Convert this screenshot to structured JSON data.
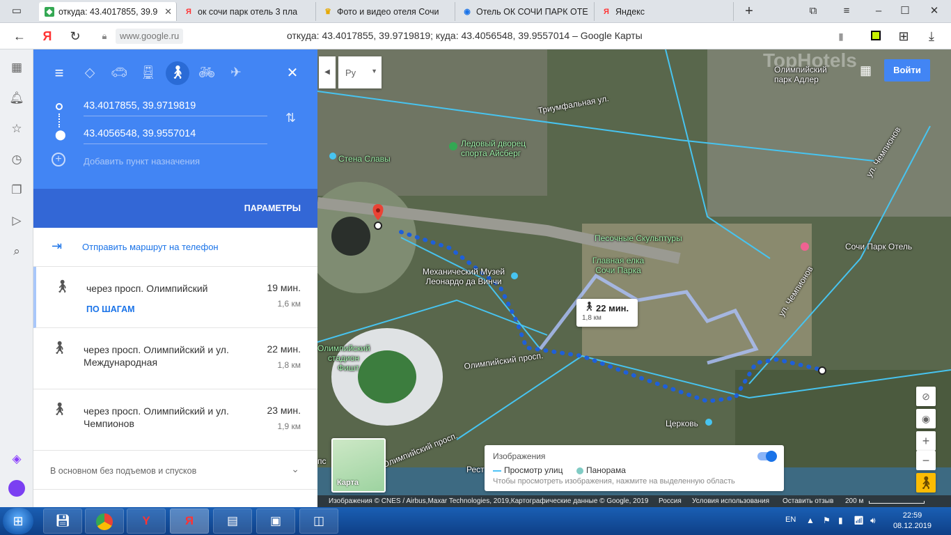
{
  "tabs": [
    {
      "title": "откуда: 43.4017855, 39.9",
      "icon": "google-maps-icon",
      "active": true
    },
    {
      "title": "ок сочи парк отель 3 пла",
      "icon": "yandex-icon"
    },
    {
      "title": "Фото и видео отеля Сочи",
      "icon": "crown-icon"
    },
    {
      "title": "Отель ОК СОЧИ ПАРК ОТЕ",
      "icon": "tripadvisor-icon"
    },
    {
      "title": "Яндекс",
      "icon": "yandex-icon"
    }
  ],
  "browser": {
    "url": "www.google.ru",
    "page_title": "откуда: 43.4017855, 39.9719819; куда: 43.4056548, 39.9557014 – Google Карты",
    "yandex_logo": "Я"
  },
  "directions": {
    "origin": "43.4017855, 39.9719819",
    "destination": "43.4056548, 39.9557014",
    "add_destination": "Добавить пункт назначения",
    "params": "ПАРАМЕТРЫ",
    "send_to_phone": "Отправить маршрут на телефон",
    "routes": [
      {
        "via": "через просп. Олимпийский",
        "time": "19 мин.",
        "distance": "1,6 км",
        "steps": "ПО ШАГАМ"
      },
      {
        "via": "через просп. Олимпийский и ул. Международная",
        "time": "22 мин.",
        "distance": "1,8 км"
      },
      {
        "via": "через просп. Олимпийский и ул. Чемпионов",
        "time": "23 мин.",
        "distance": "1,9 км"
      }
    ],
    "hills_note": "В основном без подъемов и спусков"
  },
  "map": {
    "lang": "Ру",
    "signin": "Войти",
    "watermark": "TopHotels",
    "labels": {
      "olympic_park": "Олимпийский парк Адлер",
      "triumph": "Триумфальная ул.",
      "iceberg": "Ледовый дворец спорта Айсберг",
      "glory": "Стена Славы",
      "sand": "Песочные Скульптуры",
      "tree": "Главная елка Сочи Парка",
      "museum": "Механический Музей Леонардо да Винчи",
      "fisht": "Олимпийский стадион Фишт",
      "olymp_ave": "Олимпийский просп.",
      "olymp_ave2": "Олимпийский просп.",
      "hotel": "Сочи Парк Отель",
      "champions": "ул. Чемпионов",
      "champions2": "ул. Чемпионов",
      "church": "Церковь",
      "rest": "Рест",
      "ps": "пс"
    },
    "bubble_time": "22 мин.",
    "bubble_dist": "1,8 км",
    "thumb_label": "Карта",
    "imagery_title": "Изображения",
    "imagery_street": "Просмотр улиц",
    "imagery_pano": "Панорама",
    "imagery_hint": "Чтобы просмотреть изображения, нажмите на выделенную область",
    "attribution": "Изображения © CNES / Airbus,Maxar Technologies, 2019,Картографические данные © Google, 2019",
    "attr_country": "Россия",
    "attr_terms": "Условия использования",
    "attr_feedback": "Оставить отзыв",
    "scale": "200 м"
  },
  "taskbar": {
    "lang": "EN",
    "time": "22:59",
    "date": "08.12.2019"
  }
}
